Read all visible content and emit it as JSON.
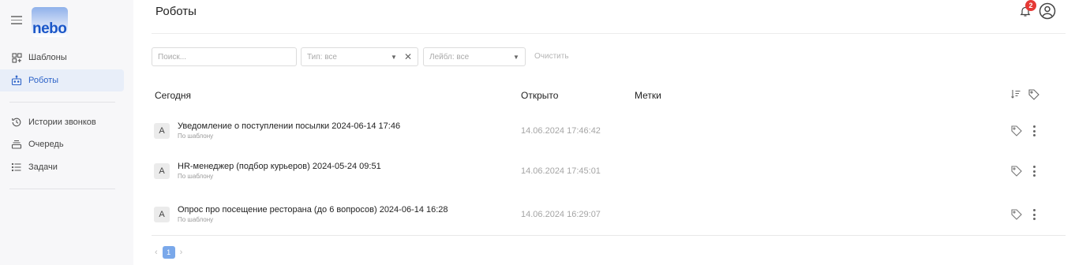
{
  "sidebar": {
    "logo_text": "nebo",
    "items": [
      {
        "label": "Шаблоны",
        "icon": "templates-icon",
        "active": false
      },
      {
        "label": "Роботы",
        "icon": "robot-icon",
        "active": true
      },
      {
        "label": "Истории звонков",
        "icon": "history-icon",
        "active": false
      },
      {
        "label": "Очередь",
        "icon": "queue-icon",
        "active": false
      },
      {
        "label": "Задачи",
        "icon": "tasks-icon",
        "active": false
      }
    ]
  },
  "header": {
    "title": "Роботы",
    "notification_count": "2"
  },
  "filters": {
    "search_placeholder": "Поиск...",
    "type_value": "Тип: все",
    "label_value": "Лейбл: все",
    "clear_label": "Очистить"
  },
  "table": {
    "columns": {
      "group": "Сегодня",
      "opened": "Открыто",
      "tags": "Метки"
    },
    "rows": [
      {
        "avatar": "A",
        "title": "Уведомление о поступлении посылки 2024-06-14 17:46",
        "subtitle": "По шаблону",
        "opened": "14.06.2024 17:46:42"
      },
      {
        "avatar": "A",
        "title": "HR-менеджер (подбор курьеров) 2024-05-24 09:51",
        "subtitle": "По шаблону",
        "opened": "14.06.2024 17:45:01"
      },
      {
        "avatar": "A",
        "title": "Опрос про посещение ресторана (до 6 вопросов) 2024-06-14 16:28",
        "subtitle": "По шаблону",
        "opened": "14.06.2024 16:29:07"
      }
    ]
  },
  "pagination": {
    "current_page": "1"
  },
  "colors": {
    "accent": "#2d63c8",
    "active_bg": "#e8eef9",
    "badge": "#e53935",
    "page_button": "#7aa8ea"
  }
}
